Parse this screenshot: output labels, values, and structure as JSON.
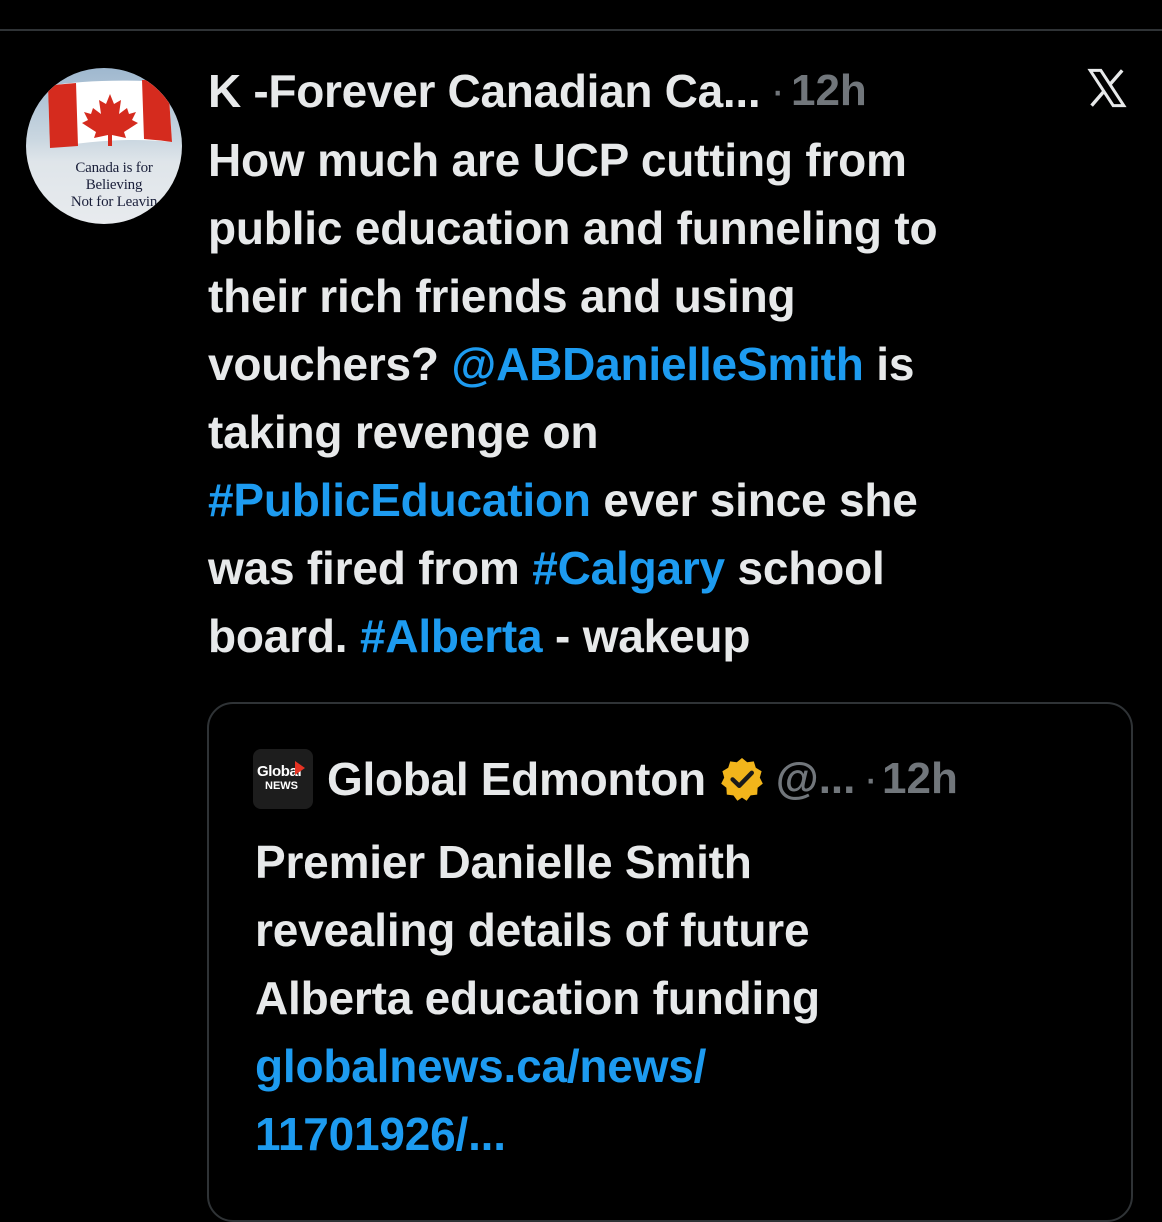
{
  "colors": {
    "background": "#000000",
    "text": "#e7e9ea",
    "muted": "#71767b",
    "link": "#1d9bf0",
    "border": "#2f3336",
    "verified_badge": "#f2b51b"
  },
  "tweet": {
    "avatar": {
      "icon": "canada-flag-avatar",
      "text_lines": [
        "Canada is for",
        "Believing",
        "Not for Leavin"
      ]
    },
    "author_name": "K -Forever Canadian Ca...",
    "separator": "·",
    "time": "12h",
    "close_icon": "x-logo-icon",
    "text_lines": [
      [
        {
          "t": "How much are UCP cutting from",
          "link": false
        }
      ],
      [
        {
          "t": "public education and funneling to",
          "link": false
        }
      ],
      [
        {
          "t": "their rich friends and using",
          "link": false
        }
      ],
      [
        {
          "t": "vouchers? ",
          "link": false
        },
        {
          "t": "@ABDanielleSmith",
          "link": true
        },
        {
          "t": " is",
          "link": false
        }
      ],
      [
        {
          "t": "taking revenge on",
          "link": false
        }
      ],
      [
        {
          "t": "#PublicEducation",
          "link": true
        },
        {
          "t": " ever since she",
          "link": false
        }
      ],
      [
        {
          "t": "was fired from ",
          "link": false
        },
        {
          "t": "#Calgary",
          "link": true
        },
        {
          "t": " school",
          "link": false
        }
      ],
      [
        {
          "t": "board.  ",
          "link": false
        },
        {
          "t": "#Alberta",
          "link": true
        },
        {
          "t": " - wakeup",
          "link": false
        }
      ]
    ]
  },
  "quote": {
    "logo": {
      "line1": "Global",
      "line2": "NEWS",
      "icon": "global-news-logo-icon"
    },
    "name": "Global Edmonton",
    "verified_icon": "verified-badge-icon",
    "handle": "@...",
    "separator": "·",
    "time": "12h",
    "text_lines": [
      [
        {
          "t": "Premier Danielle Smith",
          "link": false
        }
      ],
      [
        {
          "t": "revealing details of future",
          "link": false
        }
      ],
      [
        {
          "t": "Alberta education funding",
          "link": false
        }
      ],
      [
        {
          "t": "globalnews.ca/news/",
          "link": true
        }
      ],
      [
        {
          "t": "11701926/...",
          "link": true
        }
      ]
    ]
  }
}
